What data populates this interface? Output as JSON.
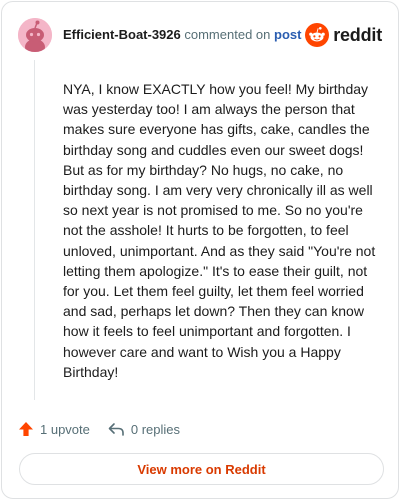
{
  "comment": {
    "author": "Efficient-Boat-3926",
    "action_text": "commented on",
    "post_link": "post",
    "body": "NYA, I know EXACTLY how you feel! My birthday was yesterday too! I am always the person that makes sure everyone has gifts, cake, candles the birthday song and cuddles even our sweet dogs! But as for my birthday? No hugs, no cake, no birthday song. I am very very chronically ill as well so next year is not promised to me. So no you're not the asshole! It hurts to be forgotten, to feel unloved, unimportant. And as they said \"You're not letting them apologize.\" It's to ease their guilt, not for you. Let them feel guilty, let them feel worried and sad, perhaps let down? Then they can know how it feels to feel unimportant and forgotten. I however care and want to Wish you a Happy Birthday!",
    "upvotes": "1 upvote",
    "replies": "0 replies"
  },
  "brand": {
    "name": "reddit",
    "color": "#ff4500"
  },
  "footer": {
    "view_more": "View more on Reddit"
  },
  "icons": {
    "upvote": "upvote-arrow-icon",
    "reply": "reply-arrow-icon",
    "brand": "reddit-snoo-icon",
    "avatar": "snoo-avatar"
  },
  "colors": {
    "author_text": "#1c1c1c",
    "secondary_text": "#576f76",
    "link": "#2a5db0",
    "cta": "#d93a00",
    "upvote": "#ff4500",
    "avatar_bg": "#f4b6c8"
  }
}
